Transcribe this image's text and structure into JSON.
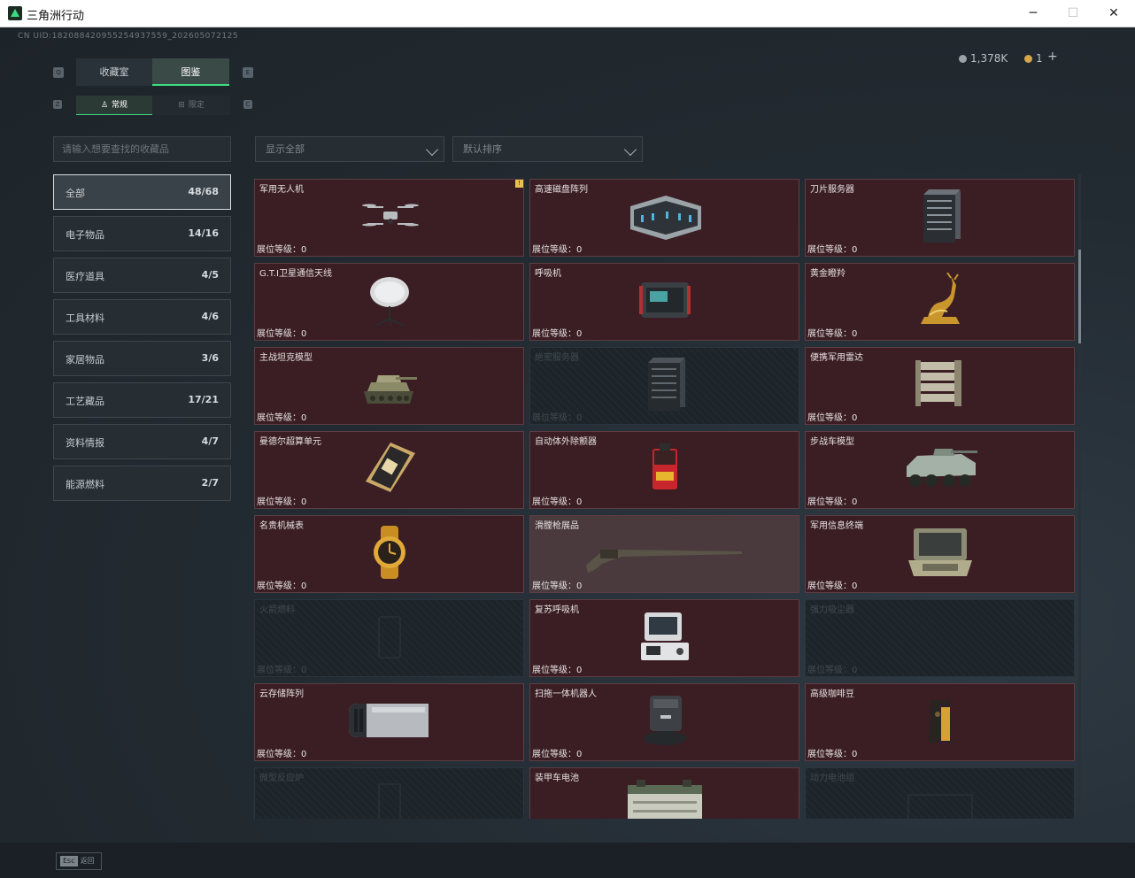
{
  "window": {
    "title": "三角洲行动",
    "minimize": "─",
    "maximize": "☐",
    "close": "✕"
  },
  "header": {
    "uid": "CN UID:1820884209552549375​59_202605072125",
    "currency_1": "1,378K",
    "currency_2": "1",
    "add": "+"
  },
  "tabs": [
    {
      "label": "收藏室"
    },
    {
      "label": "图鉴"
    }
  ],
  "subtabs": [
    {
      "label": "常规"
    },
    {
      "label": "限定"
    }
  ],
  "keys": {
    "q": "Q",
    "e": "E",
    "z": "Z",
    "c": "C"
  },
  "filters": {
    "search_placeholder": "请输入想要查找的收藏品",
    "show_all": "显示全部",
    "sort": "默认排序"
  },
  "categories": [
    {
      "name": "全部",
      "count": "48/68"
    },
    {
      "name": "电子物品",
      "count": "14/16"
    },
    {
      "name": "医疗道具",
      "count": "4/5"
    },
    {
      "name": "工具材料",
      "count": "4/6"
    },
    {
      "name": "家居物品",
      "count": "3/6"
    },
    {
      "name": "工艺藏品",
      "count": "17/21"
    },
    {
      "name": "资料情报",
      "count": "4/7"
    },
    {
      "name": "能源燃料",
      "count": "2/7"
    }
  ],
  "items": [
    {
      "name": "军用无人机",
      "level": "展位等级：0",
      "locked": false,
      "icon": "drone-icon"
    },
    {
      "name": "高速磁盘阵列",
      "level": "展位等级：0",
      "locked": false,
      "icon": "disk-array-icon"
    },
    {
      "name": "刀片服务器",
      "level": "展位等级：0",
      "locked": false,
      "icon": "server-icon"
    },
    {
      "name": "G.T.I卫星通信天线",
      "level": "展位等级：0",
      "locked": false,
      "icon": "satellite-dish-icon"
    },
    {
      "name": "呼吸机",
      "level": "展位等级：0",
      "locked": false,
      "icon": "ventilator-icon"
    },
    {
      "name": "黄金瞪羚",
      "level": "展位等级：0",
      "locked": false,
      "icon": "gold-gazelle-icon"
    },
    {
      "name": "主战坦克模型",
      "level": "展位等级：0",
      "locked": false,
      "icon": "tank-icon"
    },
    {
      "name": "绝密服务器",
      "level": "展位等级：0",
      "locked": true,
      "icon": "server-icon"
    },
    {
      "name": "便携军用雷达",
      "level": "展位等级：0",
      "locked": false,
      "icon": "radar-icon"
    },
    {
      "name": "曼德尔超算单元",
      "level": "展位等级：0",
      "locked": false,
      "icon": "computing-unit-icon"
    },
    {
      "name": "自动体外除颤器",
      "level": "展位等级：0",
      "locked": false,
      "icon": "defibrillator-icon"
    },
    {
      "name": "步战车模型",
      "level": "展位等级：0",
      "locked": false,
      "icon": "ifv-icon"
    },
    {
      "name": "名贵机械表",
      "level": "展位等级：0",
      "locked": false,
      "icon": "watch-icon"
    },
    {
      "name": "滑膛枪展品",
      "level": "展位等级：0",
      "locked": false,
      "icon": "musket-icon"
    },
    {
      "name": "军用信息终端",
      "level": "展位等级：0",
      "locked": false,
      "icon": "terminal-icon"
    },
    {
      "name": "火箭燃料",
      "level": "展位等级：0",
      "locked": true,
      "icon": "fuel-icon"
    },
    {
      "name": "复苏呼吸机",
      "level": "展位等级：0",
      "locked": false,
      "icon": "resuscitator-icon"
    },
    {
      "name": "强力吸尘器",
      "level": "展位等级：0",
      "locked": true,
      "icon": "vacuum-icon"
    },
    {
      "name": "云存储阵列",
      "level": "展位等级：0",
      "locked": false,
      "icon": "cloud-storage-icon"
    },
    {
      "name": "扫拖一体机器人",
      "level": "展位等级：0",
      "locked": false,
      "icon": "robot-vacuum-icon"
    },
    {
      "name": "高级咖啡豆",
      "level": "展位等级：0",
      "locked": false,
      "icon": "coffee-bag-icon"
    },
    {
      "name": "微型反应炉",
      "level": "",
      "locked": true,
      "icon": "reactor-icon"
    },
    {
      "name": "装甲车电池",
      "level": "",
      "locked": false,
      "icon": "battery-icon"
    },
    {
      "name": "动力电池组",
      "level": "",
      "locked": true,
      "icon": "battery-pack-icon"
    }
  ],
  "footer": {
    "esc_key": "Esc",
    "esc_label": "返回"
  },
  "colors": {
    "accent": "#3ddc84",
    "card_bg": "#3a1e24",
    "locked_bg": "#1d252b",
    "badge": "#e8c24a"
  }
}
